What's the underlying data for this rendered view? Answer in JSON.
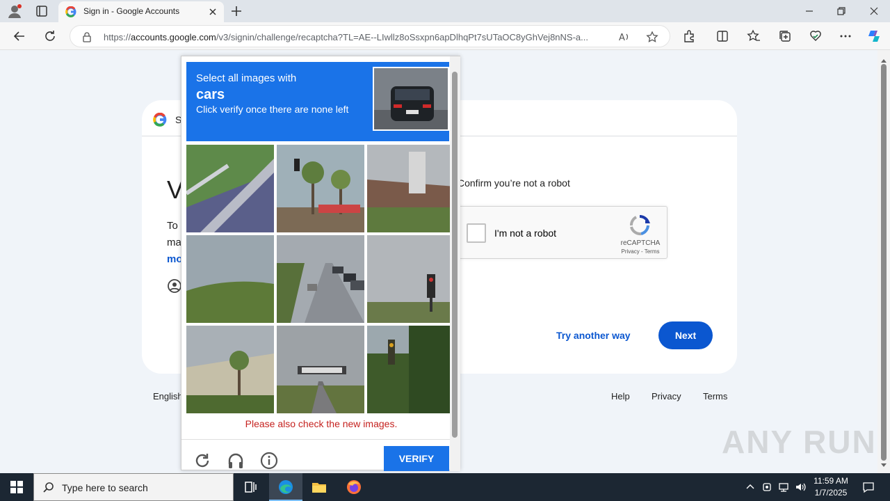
{
  "browser": {
    "tab_title": "Sign in - Google Accounts",
    "url_prefix": "https://",
    "url_host": "accounts.google.com",
    "url_path": "/v3/signin/challenge/recaptcha?TL=AE--LIwllz8oSsxpn6apDlhqPt7sUTaOC8yGhVej8nNS-a..."
  },
  "card": {
    "header_text": "S",
    "title": "V",
    "body_line1": "To",
    "body_line2": "ma",
    "link_text": "mo",
    "confirm_text": "Confirm you’re not a robot"
  },
  "recaptcha": {
    "checkbox_label": "I'm not a robot",
    "brand": "reCAPTCHA",
    "links": "Privacy - Terms"
  },
  "actions": {
    "try_another": "Try another way",
    "next": "Next"
  },
  "footer": {
    "language": "English",
    "help": "Help",
    "privacy": "Privacy",
    "terms": "Terms"
  },
  "challenge": {
    "line1": "Select all images with",
    "target": "cars",
    "line3": "Click verify once there are none left",
    "error": "Please also check the new images.",
    "verify": "VERIFY"
  },
  "watermark": "ANY RUN",
  "taskbar": {
    "search_placeholder": "Type here to search",
    "time": "11:59 AM",
    "date": "1/7/2025"
  },
  "icons": {
    "refresh": "refresh-icon",
    "audio": "headphones-icon",
    "info": "info-icon"
  }
}
